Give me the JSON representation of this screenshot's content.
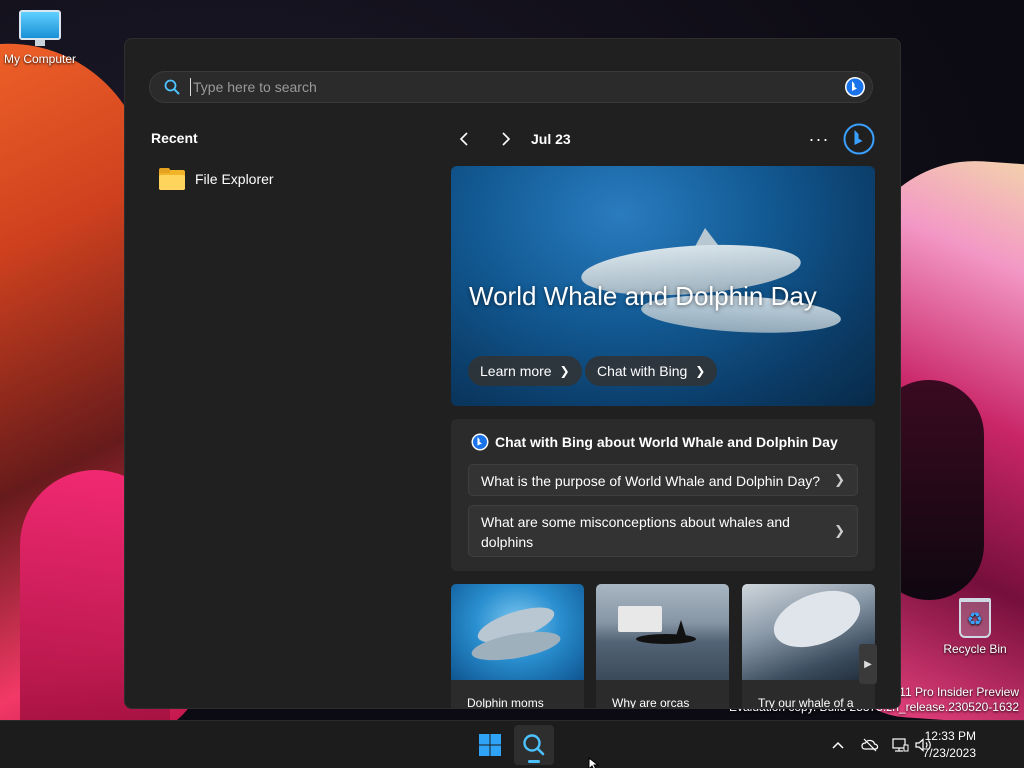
{
  "desktop": {
    "my_computer_label": "My Computer",
    "recycle_bin_label": "Recycle Bin",
    "watermark_line1": "s 11 Pro Insider Preview",
    "watermark_line2": "Evaluation copy. Build 25375.zn_release.230520-1632"
  },
  "search": {
    "placeholder": "Type here to search",
    "value": ""
  },
  "recent": {
    "title": "Recent",
    "items": [
      {
        "label": "File Explorer",
        "icon": "file-explorer-icon"
      }
    ]
  },
  "nav": {
    "date": "Jul 23",
    "more_label": "···"
  },
  "hero": {
    "title": "World Whale and Dolphin Day",
    "learn_more": "Learn more",
    "chat_with_bing": "Chat with Bing"
  },
  "chat": {
    "heading": "Chat with Bing about World Whale and Dolphin Day",
    "questions": [
      "What is the purpose of World Whale and Dolphin Day?",
      "What are some misconceptions about whales and dolphins"
    ]
  },
  "tiles": [
    {
      "caption": "Dolphin moms"
    },
    {
      "caption": "Why are orcas"
    },
    {
      "caption": "Try our whale of a"
    }
  ],
  "taskbar": {
    "time": "12:33 PM",
    "date": "7/23/2023"
  },
  "colors": {
    "panel_bg": "#202020",
    "card_bg": "#2b2b2b",
    "accent": "#3aa0ff",
    "taskbar_bg": "#1c1c1c"
  }
}
